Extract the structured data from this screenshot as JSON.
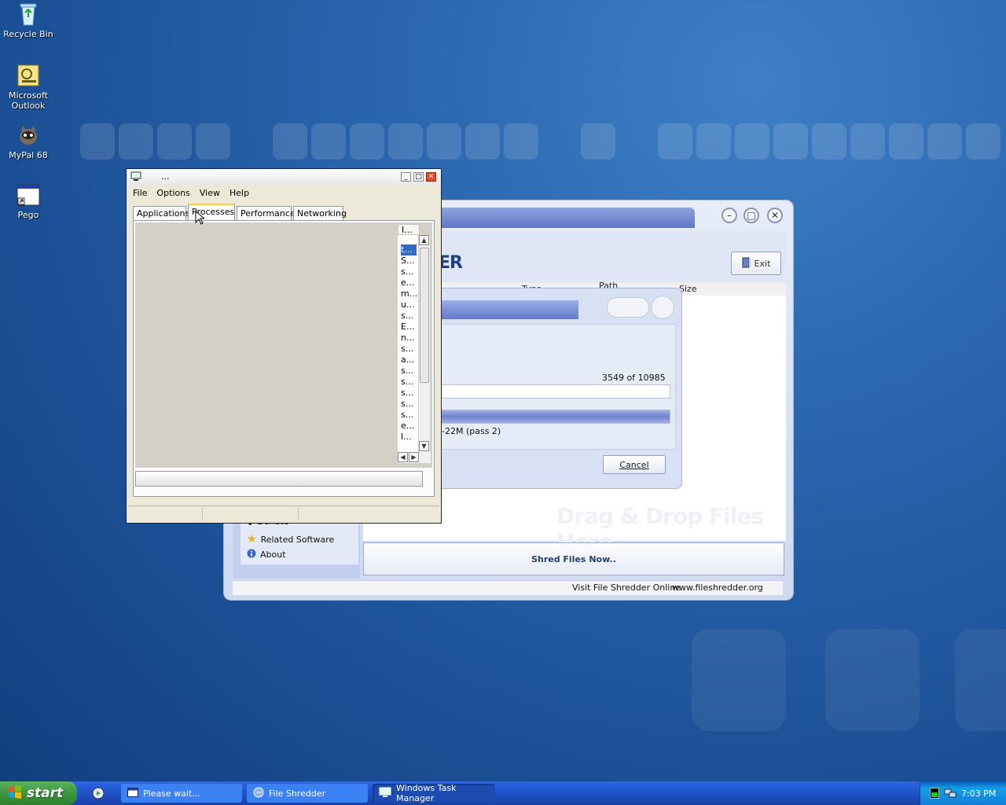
{
  "desktop": {
    "icons": [
      {
        "label": "Recycle Bin",
        "icon": "recycle-bin-icon"
      },
      {
        "label": "Microsoft Outlook",
        "icon": "outlook-icon"
      },
      {
        "label": "MyPal 68",
        "icon": "mypal-icon"
      },
      {
        "label": "Pego",
        "icon": "window-shortcut-icon"
      }
    ]
  },
  "file_shredder": {
    "logo_text": "ER",
    "exit_label": "Exit",
    "columns": [
      "Type",
      "Path",
      "Size"
    ],
    "drag_drop_hint": "Drag & Drop Files Here",
    "shred_button": "Shred Files Now..",
    "sidebar": [
      {
        "label": "Donate",
        "icon": "donate-icon"
      },
      {
        "label": "Related Software",
        "icon": "star-icon"
      },
      {
        "label": "About",
        "icon": "info-icon"
      }
    ],
    "status_text": "Visit File Shredder Online",
    "status_url": "www.fileshredder.org"
  },
  "progress_dialog": {
    "count_text": "3549  of  10985",
    "pass_text": "-22M  (pass 2)",
    "cancel_label": "Cancel",
    "progress_top": 0.0,
    "progress_bottom": 1.0
  },
  "task_manager": {
    "title": "...",
    "menus": [
      "File",
      "Options",
      "View",
      "Help"
    ],
    "tabs": [
      "Applications",
      "Processes",
      "Performance",
      "Networking"
    ],
    "active_tab": "Processes",
    "column_header": "I...",
    "processes": [
      "t...",
      "S...",
      "s...",
      "e...",
      "m...",
      "u...",
      "s...",
      "E...",
      "n...",
      "s...",
      "a...",
      "s...",
      "s...",
      "s...",
      "s...",
      "s...",
      "e...",
      "l..."
    ]
  },
  "taskbar": {
    "start_label": "start",
    "buttons": [
      {
        "label": "Please wait...",
        "icon": "window-icon",
        "active": false
      },
      {
        "label": "File Shredder",
        "icon": "shredder-icon",
        "active": false
      },
      {
        "label": "Windows Task Manager",
        "icon": "taskmanager-icon",
        "active": true
      }
    ],
    "clock": "7:03 PM"
  },
  "colors": {
    "desktop": "#2a65ad",
    "taskbar": "#245edb",
    "start": "#3c963c",
    "accent_tab": "#ffc83c"
  }
}
